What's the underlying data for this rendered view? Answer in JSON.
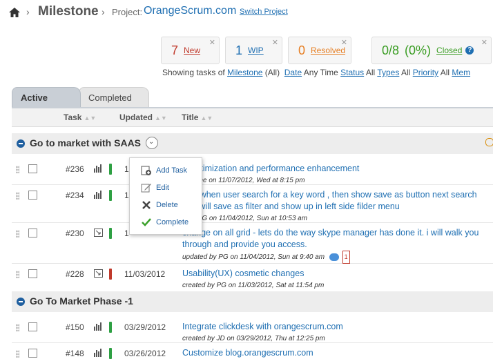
{
  "breadcrumb": {
    "title": "Milestone",
    "project_label": "Project:",
    "project_name": "OrangeScrum.com",
    "switch_project": "Switch Project"
  },
  "stats": {
    "new": {
      "count": "7",
      "label": "New"
    },
    "wip": {
      "count": "1",
      "label": "WIP"
    },
    "resolved": {
      "count": "0",
      "label": "Resolved"
    },
    "closed": {
      "count": "0/8",
      "percent": "(0%)",
      "label": "Closed"
    }
  },
  "filters": {
    "prefix": "Showing tasks of",
    "milestone_label": "Milestone",
    "milestone_value": "(All)",
    "date_label": "Date",
    "date_value": "Any Time",
    "status_label": "Status",
    "status_value": "All",
    "types_label": "Types",
    "types_value": "All",
    "priority_label": "Priority",
    "priority_value": "All",
    "members_label": "Mem"
  },
  "tabs": {
    "active": "Active",
    "completed": "Completed"
  },
  "columns": {
    "task": "Task",
    "updated": "Updated",
    "title": "Title"
  },
  "groups": [
    {
      "name": "Go to market with SAAS",
      "tasks": [
        {
          "id": "#236",
          "updated": "1",
          "title": "y Optimization and performance enhancement",
          "meta": "d by me on 11/07/2012, Wed at 8:15 pm",
          "priority_color": "#2ea043"
        },
        {
          "id": "#234",
          "updated": "1",
          "title": "As - when user search for a key word , then show save as button next search",
          "title2": "that will save as filter and show up in left side filder menu",
          "meta": "d by PG on 11/04/2012, Sun at 10:53 am",
          "priority_color": "#2ea043"
        },
        {
          "id": "#230",
          "updated": "1",
          "title": "change on all grid - lets do the way skype manager has done it. i will walk you",
          "title2": "through and provide you access.",
          "meta": "updated by PG on 11/04/2012, Sun at 9:40 am",
          "comments": "1",
          "priority_color": "#2ea043"
        },
        {
          "id": "#228",
          "updated": "11/03/2012",
          "title": "Usability(UX) cosmetic changes",
          "meta": "created by PG on 11/03/2012, Sat at 11:54 pm",
          "priority_color": "#c0392b"
        }
      ]
    },
    {
      "name": "Go To Market Phase -1",
      "tasks": [
        {
          "id": "#150",
          "updated": "03/29/2012",
          "title": "Integrate clickdesk with orangescrum.com",
          "meta": "created by JD on 03/29/2012, Thu at 12:25 pm",
          "priority_color": "#2ea043"
        },
        {
          "id": "#148",
          "updated": "03/26/2012",
          "title": "Customize blog.orangescrum.com",
          "meta": "",
          "priority_color": "#2ea043"
        }
      ]
    }
  ],
  "menu": {
    "add_task": "Add Task",
    "edit": "Edit",
    "delete": "Delete",
    "complete": "Complete"
  }
}
